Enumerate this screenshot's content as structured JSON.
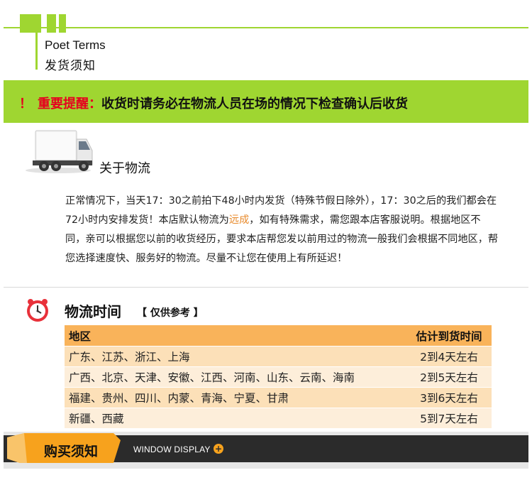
{
  "header": {
    "title_en": "Poet Terms",
    "title_cn": "发货须知"
  },
  "warning": {
    "exclaim": "！",
    "label": "重要提醒：",
    "message": "收货时请务必在物流人员在场的情况下检查确认后收货"
  },
  "logistics": {
    "title": "关于物流",
    "para_part1": "正常情况下，当天17：30之前拍下48小时内发货（特殊节假日除外），17：30之后的我们都会在72小时内安排发货！本店默认物流为",
    "para_highlight": "远成",
    "para_part2": "，如有特殊需求，需您跟本店客服说明。根据地区不同，亲可以根据您以前的收货经历，要求本店帮您发以前用过的物流一般我们会根据不同地区，帮您选择速度快、服务好的物流。尽量不让您在使用上有所延迟！"
  },
  "shipping_time": {
    "title": "物流时间",
    "note": "【 仅供参考 】",
    "headers": [
      "地区",
      "估计到货时间"
    ],
    "rows": [
      [
        "广东、江苏、浙江、上海",
        "2到4天左右"
      ],
      [
        "广西、北京、天津、安徽、江西、河南、山东、云南、海南",
        "2到5天左右"
      ],
      [
        "福建、贵州、四川、内蒙、青海、宁夏、甘肃",
        "3到6天左右"
      ],
      [
        "新疆、西藏",
        "5到7天左右"
      ]
    ]
  },
  "bottom_bar": {
    "buy_label": "购买须知",
    "window_display": "WINDOW DISPLAY",
    "plus_glyph": "+"
  },
  "colors": {
    "accent_green": "#9fd631",
    "warn_red": "#e6001f",
    "table_header": "#f9b35a",
    "table_row_odd": "#fce0b8",
    "table_row_even": "#fdeeda",
    "bar_dark": "#2b2b2b",
    "tab_orange": "#f7a21d"
  }
}
